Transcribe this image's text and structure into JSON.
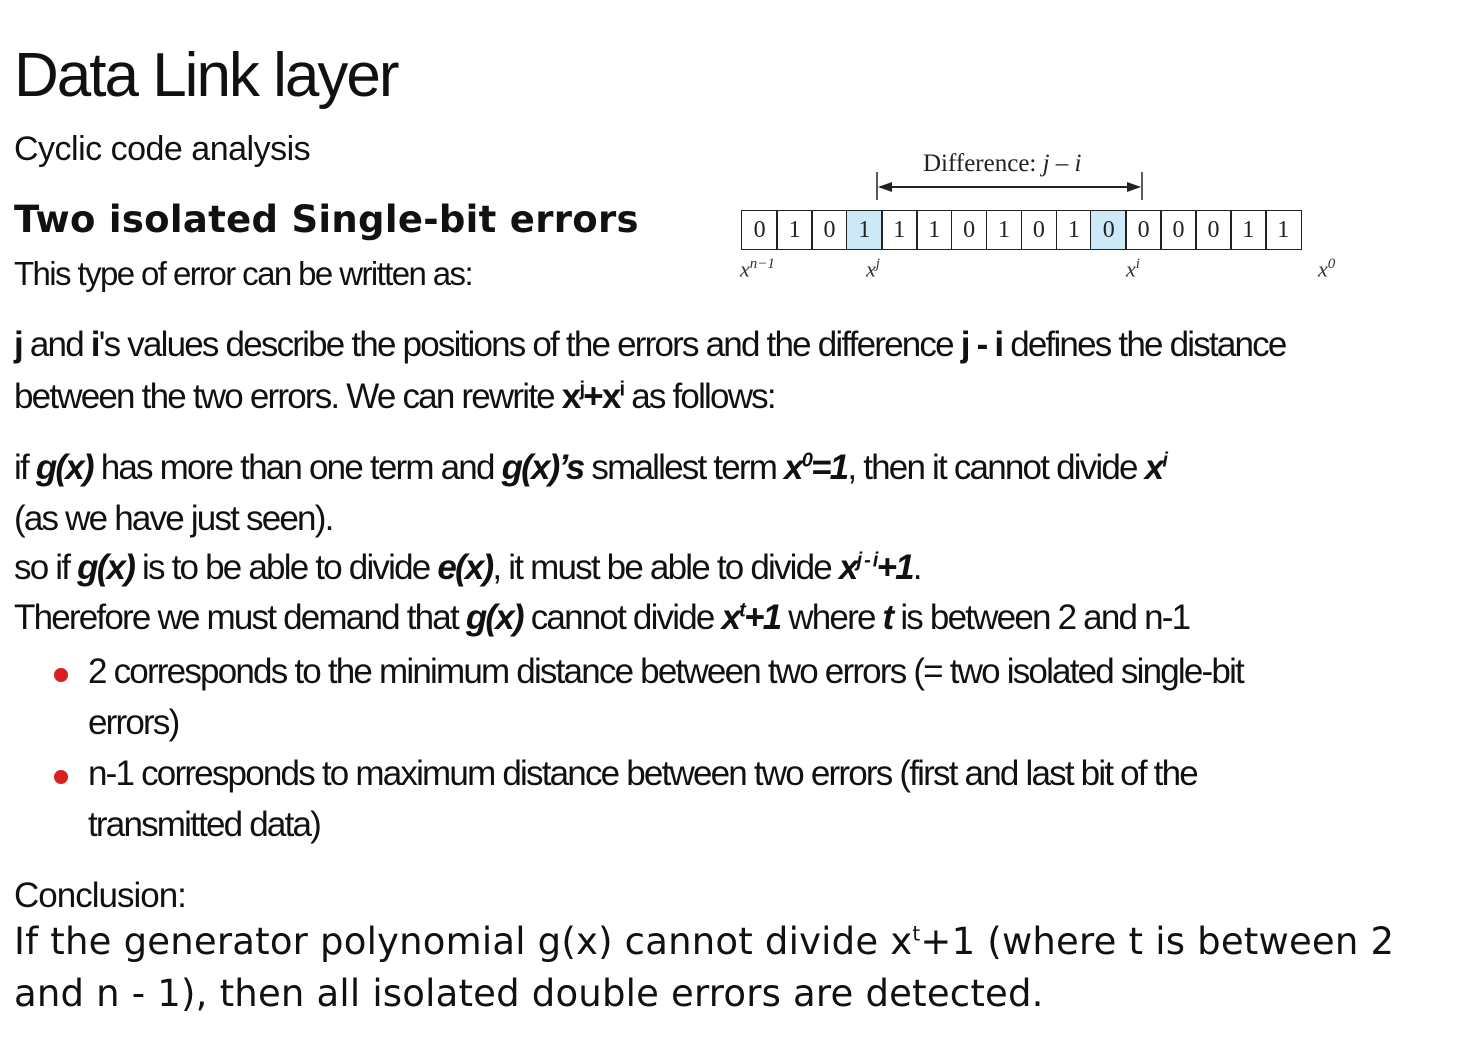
{
  "title": "Data Link layer",
  "subtitle": "Cyclic code analysis",
  "section_heading": "Two isolated Single-bit errors",
  "intro": "This type of error can be written as:",
  "diagram": {
    "difference_label": "Difference: ",
    "difference_expr": "j – i",
    "bits": [
      "0",
      "1",
      "0",
      "1",
      "1",
      "1",
      "0",
      "1",
      "0",
      "1",
      "0",
      "0",
      "0",
      "0",
      "1",
      "1"
    ],
    "highlighted_indices": [
      3,
      10
    ],
    "highlight_color": "#cde8f6",
    "position_labels": {
      "n_minus_1_base": "x",
      "n_minus_1_exp": "n−1",
      "j_base": "x",
      "j_exp": "j",
      "i_base": "x",
      "i_exp": "i",
      "zero_base": "x",
      "zero_exp": "0"
    }
  },
  "para1": {
    "j": "j",
    "and": " and ",
    "i": "i",
    "rest1": "'s values describe the positions of the errors and the difference ",
    "jmi": "j - i",
    "rest2": " defines the distance",
    "line2a": "between the two errors. We can rewrite ",
    "xj_base": "x",
    "xj_exp": "j",
    "plus": "+",
    "xi_base": "x",
    "xi_exp": "i",
    "line2b": " as follows:"
  },
  "para2": {
    "if": "if ",
    "gx1": "g(x)",
    "t1": " has more than one term and ",
    "gx2": "g(x)’s",
    "t2": " smallest term ",
    "x0_base": "x",
    "x0_exp": "0",
    "x0_eq": "=1",
    "t3": ", then it cannot divide ",
    "xi_base": "x",
    "xi_exp": "i",
    "line2": "(as we have just seen).",
    "so_if": "so if ",
    "gx3": "g(x)",
    "t4": " is to be able to divide ",
    "ex": "e(x)",
    "t5": ", it must be able to divide ",
    "xji_base": "x",
    "xji_exp": "j - i",
    "xji_tail": "+1",
    "period": ".",
    "therefore": "Therefore we must demand that ",
    "gx4": "g(x)",
    "t6": " cannot divide ",
    "xt_base": "x",
    "xt_exp": "t",
    "xt_tail": "+1",
    "where": " where ",
    "t_var": "t",
    "t7": " is between 2 and n-1"
  },
  "bullets": [
    {
      "line1": "2 corresponds to the minimum distance between two errors (= two isolated single-bit",
      "line2": "errors)"
    },
    {
      "line1": "n-1 corresponds to maximum distance between two errors (first and last bit of the",
      "line2": "transmitted data)"
    }
  ],
  "bullet_color": "#d92020",
  "conclusion": {
    "label": "Conclusion:",
    "line1a": "If the generator polynomial g(x) cannot divide x",
    "line1_exp": "t",
    "line1b": "+1 (where t is between 2",
    "line2": "and n - 1), then all isolated double errors are detected."
  }
}
